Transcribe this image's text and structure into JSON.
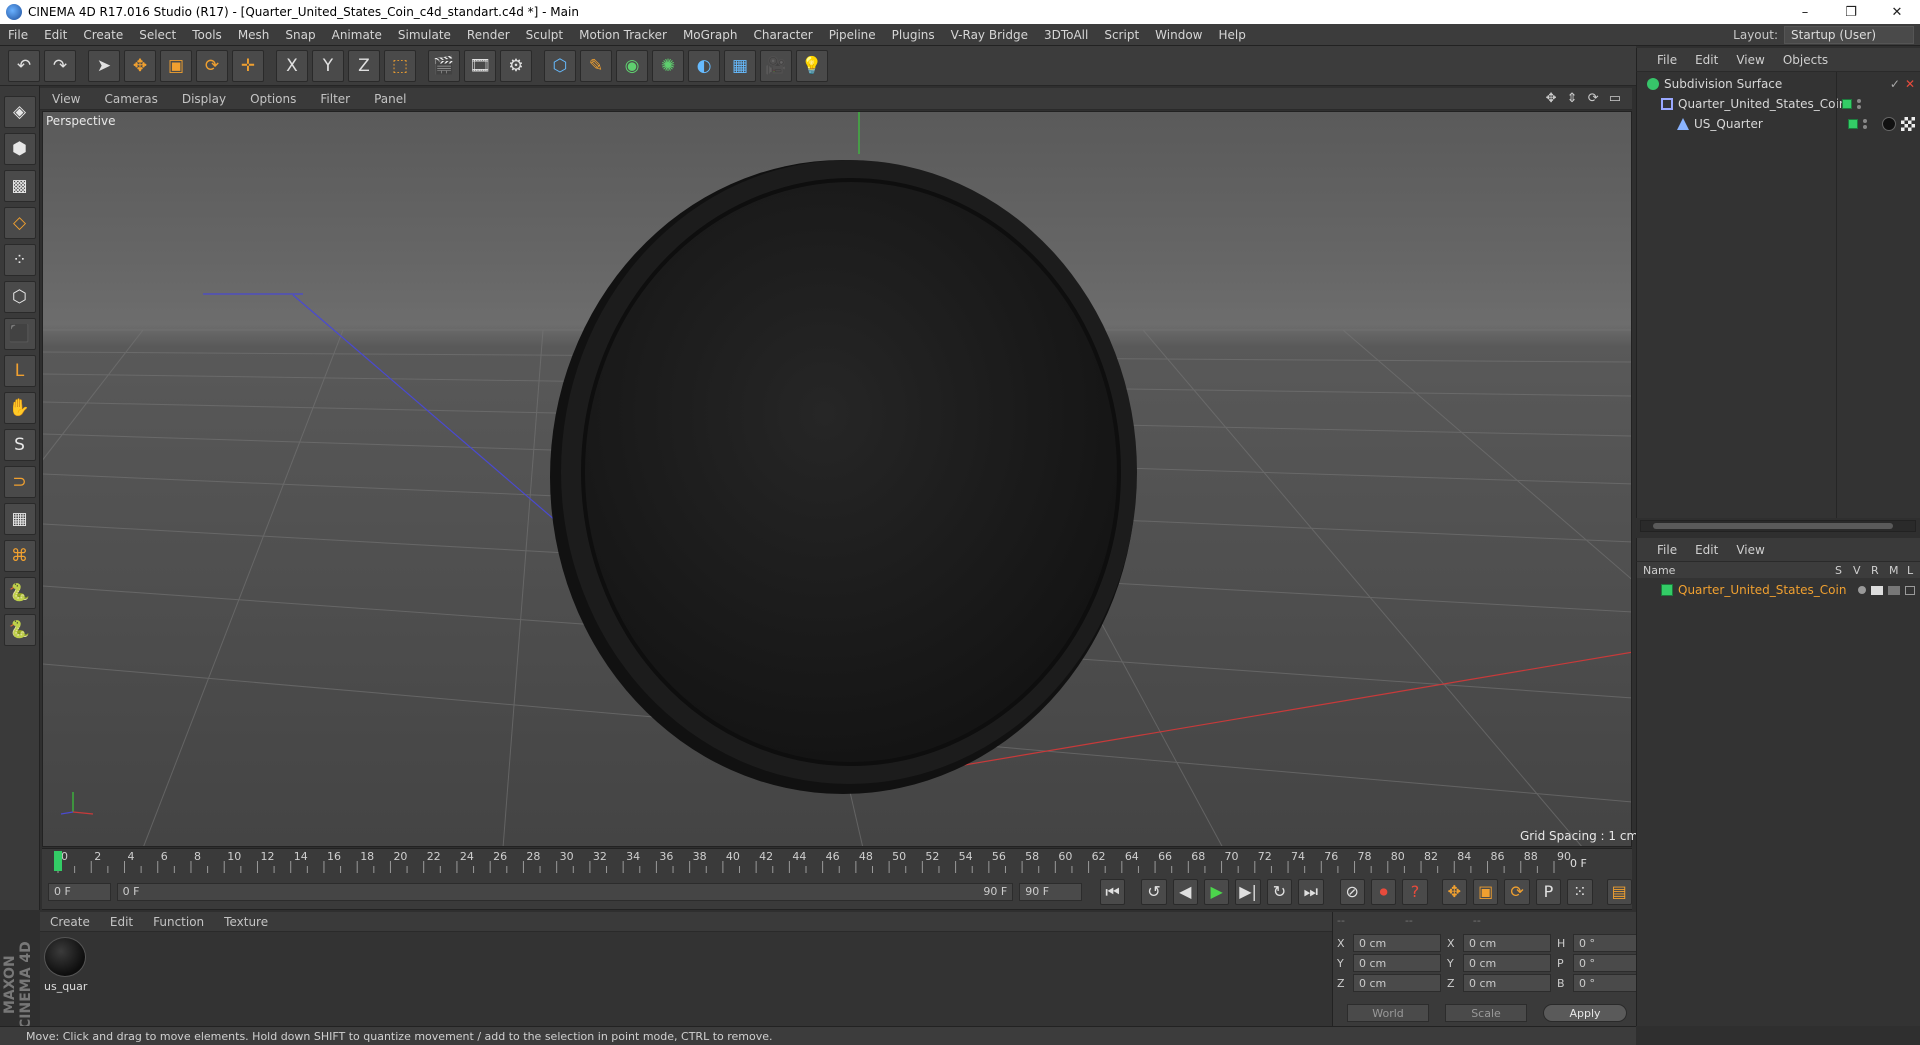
{
  "window": {
    "title": "CINEMA 4D R17.016 Studio (R17) - [Quarter_United_States_Coin_c4d_standart.c4d *] - Main",
    "buttons": [
      "–",
      "❐",
      "✕"
    ]
  },
  "menubar": {
    "items": [
      "File",
      "Edit",
      "Create",
      "Select",
      "Tools",
      "Mesh",
      "Snap",
      "Animate",
      "Simulate",
      "Render",
      "Sculpt",
      "Motion Tracker",
      "MoGraph",
      "Character",
      "Pipeline",
      "Plugins",
      "V-Ray Bridge",
      "3DToAll",
      "Script",
      "Window",
      "Help"
    ],
    "layout_label": "Layout:",
    "layout_value": "Startup (User)"
  },
  "toolbar": {
    "icons": [
      "undo-icon",
      "redo-icon",
      "select-arrow-icon",
      "move-icon",
      "scale-icon",
      "rotate-icon",
      "add-icon",
      "x-axis-icon",
      "y-axis-icon",
      "z-axis-icon",
      "coordinate-system-icon",
      "render-view-icon",
      "render-picture-viewer-icon",
      "render-settings-icon",
      "cube-icon",
      "pen-icon",
      "subdivision-icon",
      "cloner-icon",
      "deformer-icon",
      "floor-icon",
      "camera-icon",
      "light-icon"
    ],
    "glyphs": [
      "↶",
      "↷",
      "➤",
      "✥",
      "▣",
      "⟳",
      "✛",
      "X",
      "Y",
      "Z",
      "⬚",
      "🎬",
      "🎞",
      "⚙",
      "⬡",
      "✎",
      "◉",
      "✺",
      "◐",
      "▦",
      "🎥",
      "💡"
    ]
  },
  "lefttools": {
    "icons": [
      "make-editable-icon",
      "model-mode-icon",
      "texture-mode-icon",
      "workplane-icon",
      "points-mode-icon",
      "edges-mode-icon",
      "polygons-mode-icon",
      "axis-mode-icon",
      "tweak-mode-icon",
      "soft-selection-icon",
      "magnet-icon",
      "snap-icon",
      "quantize-icon",
      "python-icon",
      "python-2-icon"
    ],
    "glyphs": [
      "◈",
      "⬢",
      "▩",
      "◇",
      "⁘",
      "⬡",
      "⬛",
      "L",
      "✋",
      "S",
      "⊃",
      "▦",
      "⌘",
      "🐍",
      "🐍"
    ]
  },
  "viewport": {
    "menu": [
      "View",
      "Cameras",
      "Display",
      "Options",
      "Filter",
      "Panel"
    ],
    "nav_icons": "✥ ⇕ ⟳ ▭",
    "label": "Perspective",
    "grid_spacing": "Grid Spacing : 1 cm"
  },
  "timeline": {
    "ticks": [
      0,
      2,
      4,
      6,
      8,
      10,
      12,
      14,
      16,
      18,
      20,
      22,
      24,
      26,
      28,
      30,
      32,
      34,
      36,
      38,
      40,
      42,
      44,
      46,
      48,
      50,
      52,
      54,
      56,
      58,
      60,
      62,
      64,
      66,
      68,
      70,
      72,
      74,
      76,
      78,
      80,
      82,
      84,
      86,
      88,
      90
    ],
    "current_frame": "0 F",
    "start_frame": "0 F",
    "range_start": "0 F",
    "range_end": "90 F",
    "end_frame": "90 F"
  },
  "playback": {
    "glyphs": [
      "⏮",
      "↺",
      "◀",
      "▶",
      "▶|",
      "↻",
      "⏭"
    ],
    "key_glyphs": [
      "⊘",
      "⏺",
      "?",
      "✥",
      "▣",
      "⟳",
      "P",
      "⁙",
      "▤"
    ]
  },
  "material_manager": {
    "menu": [
      "Create",
      "Edit",
      "Function",
      "Texture"
    ],
    "material_name": "us_quar"
  },
  "brand": "MAXON CINEMA 4D",
  "coordinates": {
    "headers": [
      "--",
      "--",
      "--"
    ],
    "rows": [
      {
        "a": "X",
        "v1": "0 cm",
        "b": "X",
        "v2": "0 cm",
        "c": "H",
        "v3": "0 °"
      },
      {
        "a": "Y",
        "v1": "0 cm",
        "b": "Y",
        "v2": "0 cm",
        "c": "P",
        "v3": "0 °"
      },
      {
        "a": "Z",
        "v1": "0 cm",
        "b": "Z",
        "v2": "0 cm",
        "c": "B",
        "v3": "0 °"
      }
    ],
    "world": "World",
    "scale": "Scale",
    "apply": "Apply"
  },
  "object_manager": {
    "menu": [
      "File",
      "Edit",
      "View",
      "Objects"
    ],
    "objects": [
      {
        "name": "Subdivision Surface",
        "icon_color": "#37c46a"
      },
      {
        "name": "Quarter_United_States_Coin",
        "icon_color": "#9aa8ff"
      },
      {
        "name": "US_Quarter",
        "icon_color": "#8ab4ff"
      }
    ]
  },
  "layer_manager": {
    "menu": [
      "File",
      "Edit",
      "View"
    ],
    "columns": [
      "Name",
      "S",
      "V",
      "R",
      "M",
      "L"
    ],
    "layers": [
      {
        "name": "Quarter_United_States_Coin",
        "color": "#f0a030"
      }
    ]
  },
  "statusbar": {
    "text": "Move: Click and drag to move elements. Hold down SHIFT to quantize movement / add to the selection in point mode, CTRL to remove."
  },
  "colors": {
    "accent": "#f0a030",
    "axis_x": "#c83a3a",
    "axis_y": "#3ac83a",
    "axis_z": "#3a3ac8"
  }
}
